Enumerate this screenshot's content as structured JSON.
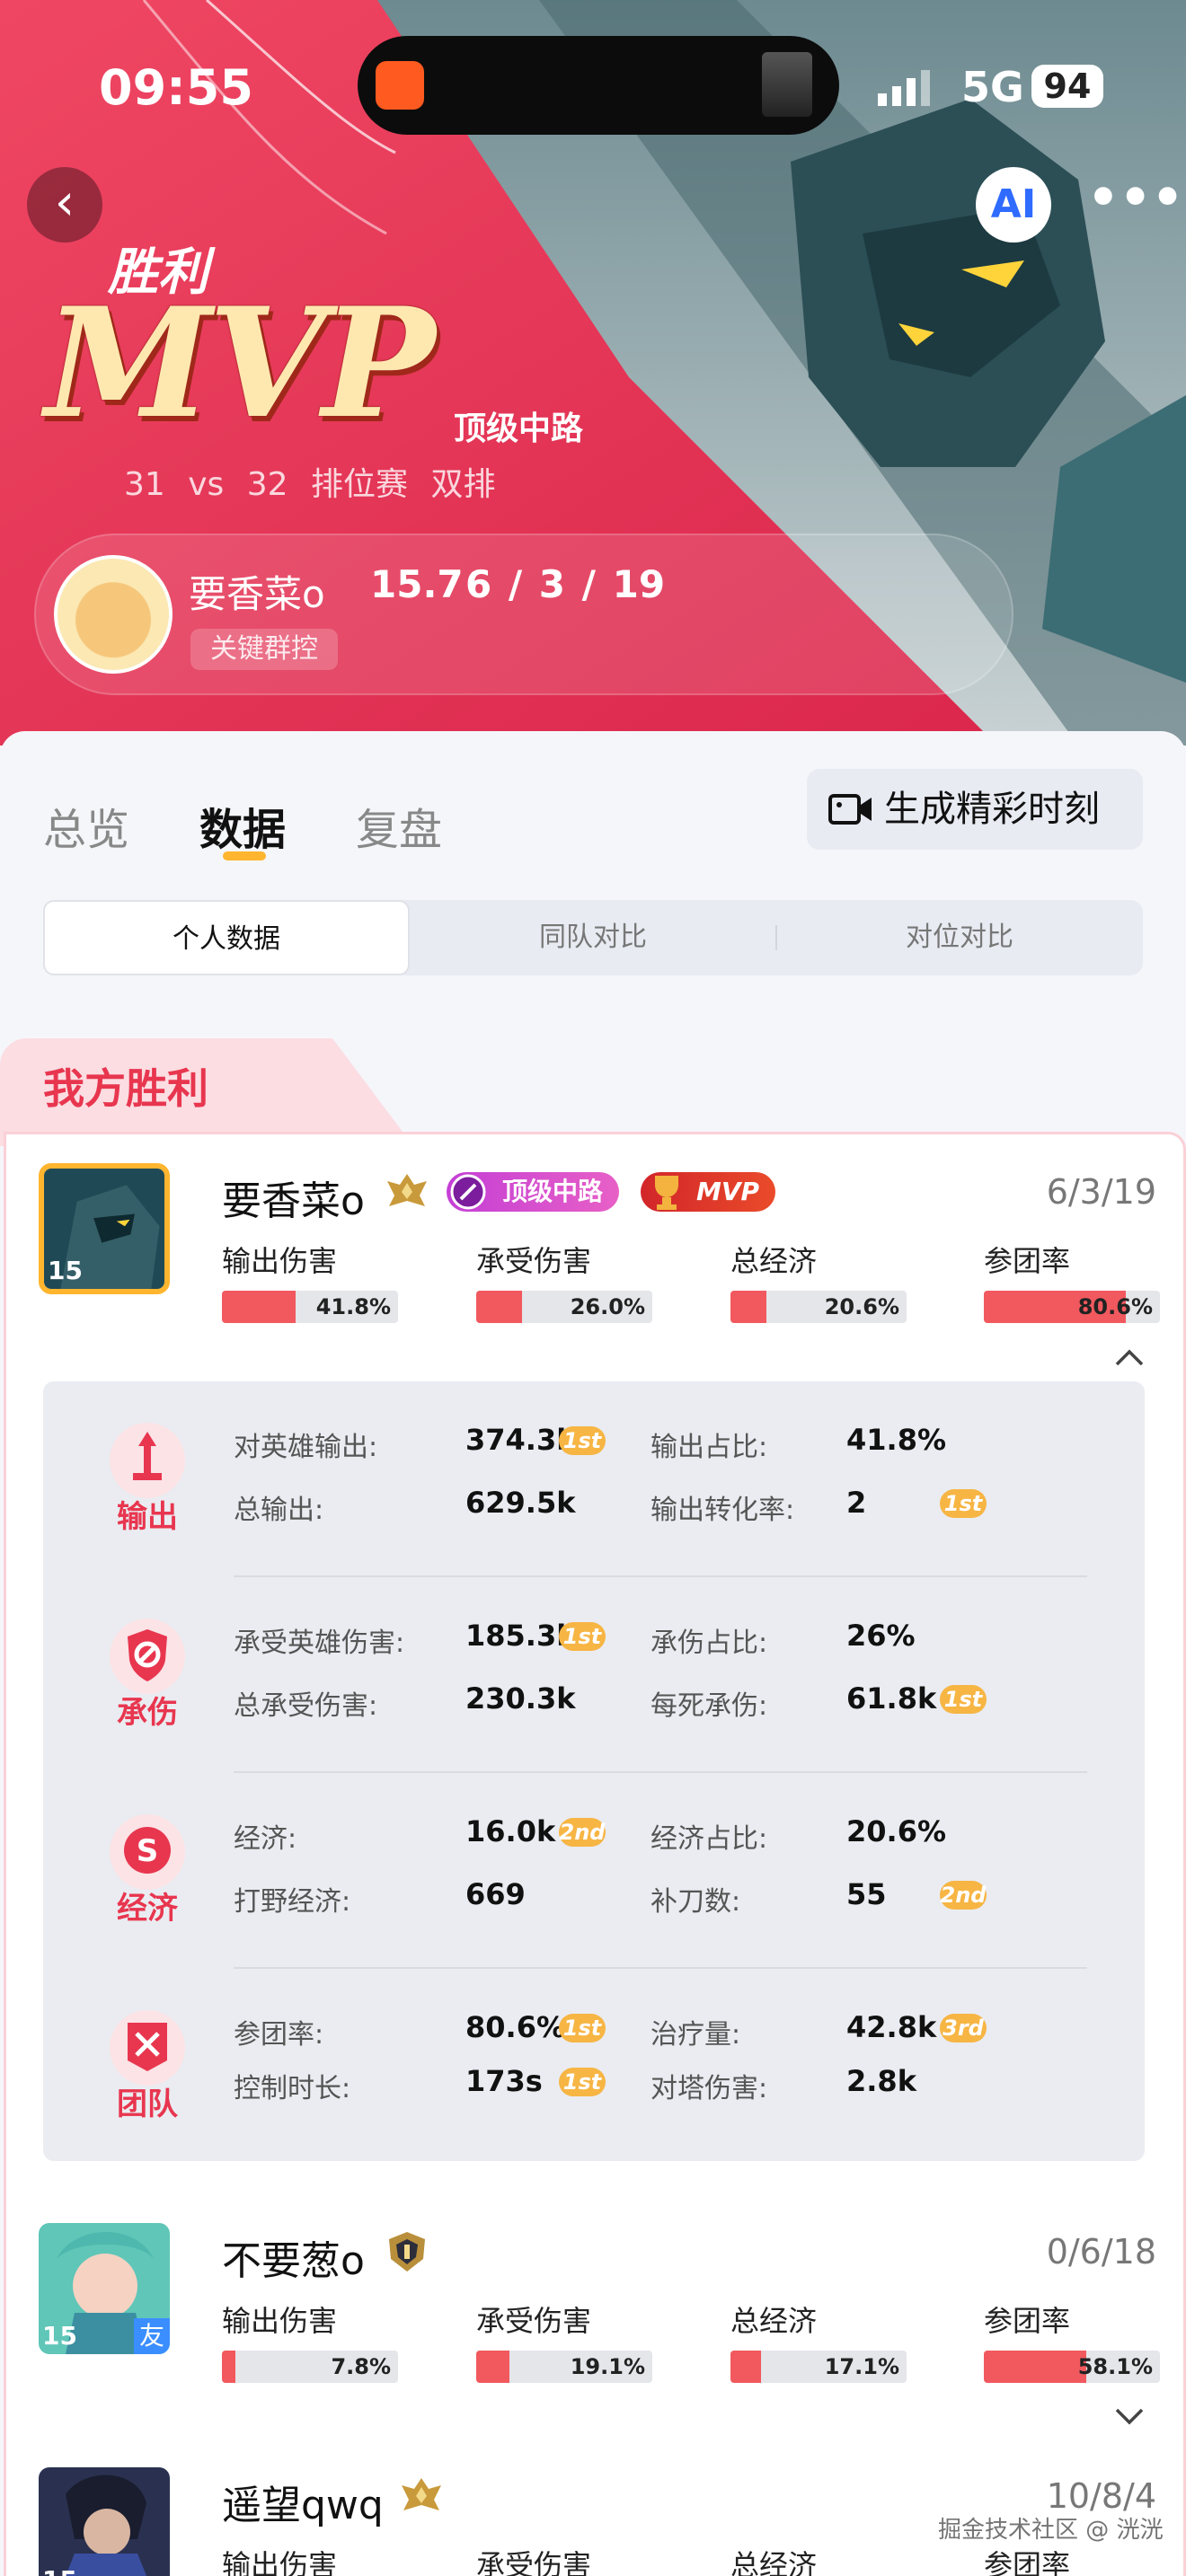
{
  "status_bar": {
    "time": "09:55",
    "network": "5G",
    "battery": "94"
  },
  "hero": {
    "result": "胜利",
    "mvp": "MVP",
    "role_title": "顶级中路",
    "match_info": "31 vs 32 排位赛 双排",
    "player": {
      "name": "要香菜o",
      "score": "15.7",
      "kda": "6 / 3 / 19",
      "tag": "关键群控"
    }
  },
  "header_buttons": {
    "ai": "AI",
    "more": "•••",
    "back": "‹"
  },
  "tabs": [
    "总览",
    "数据",
    "复盘"
  ],
  "generate_button": "生成精彩时刻",
  "segments": [
    "个人数据",
    "同队对比",
    "对位对比"
  ],
  "team_label": "我方胜利",
  "colors": {
    "accent_red": "#e8364f",
    "bar_fill": "#f1595e",
    "rank_gold": "#f7b544",
    "tab_underline": "#ffb52e"
  },
  "stat_labels": [
    "输出伤害",
    "承受伤害",
    "总经济",
    "参团率"
  ],
  "players": [
    {
      "name": "要香菜o",
      "level": "15",
      "kda": "6/3/19",
      "role_badge": "顶级中路",
      "mvp_badge": "MVP",
      "friend": "",
      "stats": [
        {
          "value": "41.8%",
          "pct": 41.8
        },
        {
          "value": "26.0%",
          "pct": 26.0
        },
        {
          "value": "20.6%",
          "pct": 20.6
        },
        {
          "value": "80.6%",
          "pct": 80.6
        }
      ]
    },
    {
      "name": "不要葱o",
      "level": "15",
      "kda": "0/6/18",
      "friend": "友",
      "stats": [
        {
          "value": "7.8%",
          "pct": 7.8
        },
        {
          "value": "19.1%",
          "pct": 19.1
        },
        {
          "value": "17.1%",
          "pct": 17.1
        },
        {
          "value": "58.1%",
          "pct": 58.1
        }
      ]
    },
    {
      "name": "遥望qwq",
      "level": "15",
      "kda": "10/8/4",
      "stats_labels_only": true
    }
  ],
  "details": [
    {
      "title": "输出",
      "rows": [
        {
          "l1": "对英雄输出:",
          "v1": "374.3k",
          "r1": "1st",
          "l2": "输出占比:",
          "v2": "41.8%",
          "r2": ""
        },
        {
          "l1": "总输出:",
          "v1": "629.5k",
          "r1": "",
          "l2": "输出转化率:",
          "v2": "2",
          "r2": "1st"
        }
      ]
    },
    {
      "title": "承伤",
      "rows": [
        {
          "l1": "承受英雄伤害:",
          "v1": "185.3k",
          "r1": "1st",
          "l2": "承伤占比:",
          "v2": "26%",
          "r2": ""
        },
        {
          "l1": "总承受伤害:",
          "v1": "230.3k",
          "r1": "",
          "l2": "每死承伤:",
          "v2": "61.8k",
          "r2": "1st"
        }
      ]
    },
    {
      "title": "经济",
      "rows": [
        {
          "l1": "经济:",
          "v1": "16.0k",
          "r1": "2nd",
          "l2": "经济占比:",
          "v2": "20.6%",
          "r2": ""
        },
        {
          "l1": "打野经济:",
          "v1": "669",
          "r1": "",
          "l2": "补刀数:",
          "v2": "55",
          "r2": "2nd"
        }
      ]
    },
    {
      "title": "团队",
      "rows": [
        {
          "l1": "参团率:",
          "v1": "80.6%",
          "r1": "1st",
          "l2": "治疗量:",
          "v2": "42.8k",
          "r2": "3rd"
        },
        {
          "l1": "控制时长:",
          "v1": "173s",
          "r1": "1st",
          "l2": "对塔伤害:",
          "v2": "2.8k",
          "r2": ""
        }
      ]
    }
  ],
  "watermark": "掘金技术社区 @ 洸洸"
}
